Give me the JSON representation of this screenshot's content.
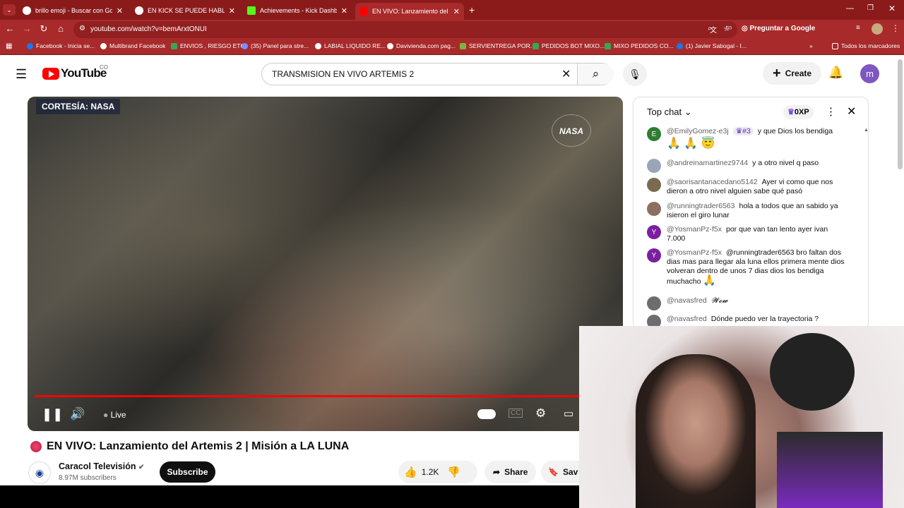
{
  "tabs": [
    {
      "title": "brillo emoji - Buscar con Googl",
      "color": "#4285f4"
    },
    {
      "title": "EN KICK SE PUEDE HABLAR DE",
      "color": "#4285f4"
    },
    {
      "title": "Achievements - Kick Dashboard",
      "color": "#53fc18"
    },
    {
      "title": "EN VIVO: Lanzamiento del A",
      "color": "#ff0000"
    }
  ],
  "address": {
    "url": "youtube.com/watch?v=bemArxtONUI",
    "ask_google": "Preguntar a Google"
  },
  "bookmarks": [
    "Facebook - Inicia se...",
    "Multibrand Facebook",
    "ENVIOS , RIESGO ETC",
    "(35) Panel para stre...",
    "LABIAL LIQUIDO RE...",
    "Davivienda.com pag...",
    "SERVIENTREGA POR...",
    "PEDIDOS BOT MIXO...",
    "MIXO PEDIDOS CO...",
    "(1) Javier Sabogal - I...",
    "Todos los marcadores"
  ],
  "youtube": {
    "logo": "YouTube",
    "country": "CO",
    "search": "TRANSMISION EN VIVO ARTEMIS 2",
    "create": "Create",
    "avatar": "m"
  },
  "player": {
    "overlay": "CORTESÍA: NASA",
    "nasa": "NASA",
    "live": "Live",
    "progress_pct": 100
  },
  "video": {
    "title": "EN VIVO: Lanzamiento del Artemis 2 | Misión a LA LUNA",
    "channel": "Caracol Televisión",
    "subscribers": "8.97M subscribers",
    "subscribe": "Subscribe",
    "likes": "1.2K",
    "share": "Share",
    "save": "Sav"
  },
  "chat": {
    "header": "Top chat",
    "xp": "0XP",
    "messages": [
      {
        "avatar": "E",
        "color": "#2e7d32",
        "author": "@EmilyGomez-e3j",
        "badge": "#3",
        "text": "y que Dios los bendiga",
        "emoji": "🙏 🙏 😇"
      },
      {
        "avatar": "",
        "color": "#9aa6b8",
        "author": "@andreinamartinez9744",
        "text": "y a otro nivel q paso"
      },
      {
        "avatar": "",
        "color": "#7a6a4f",
        "author": "@saorisantanacedano5142",
        "text": "Ayer vi como que nos dieron a otro nivel alguien sabe qué pasó"
      },
      {
        "avatar": "",
        "color": "#8d6e63",
        "author": "@runningtrader6563",
        "text": "hola a todos que an sabido ya isieron el giro lunar"
      },
      {
        "avatar": "Y",
        "color": "#7b1fa2",
        "author": "@YosmanPz-f5x",
        "text": "por que van tan lento ayer ivan 7.000"
      },
      {
        "avatar": "Y",
        "color": "#7b1fa2",
        "author": "@YosmanPz-f5x",
        "text": "@runningtrader6563 bro faltan dos dias mas para llegar ala luna ellos primera mente dios volveran dentro de unos 7 dias dios los bendiga muchacho",
        "emoji": "🙏"
      },
      {
        "avatar": "",
        "color": "#6d6d6d",
        "author": "@navasfred",
        "text": "𝓦𝓸𝔀"
      },
      {
        "avatar": "",
        "color": "#6d6d6d",
        "author": "@navasfred",
        "text": "Dónde puedo ver la trayectoria ?"
      }
    ]
  }
}
